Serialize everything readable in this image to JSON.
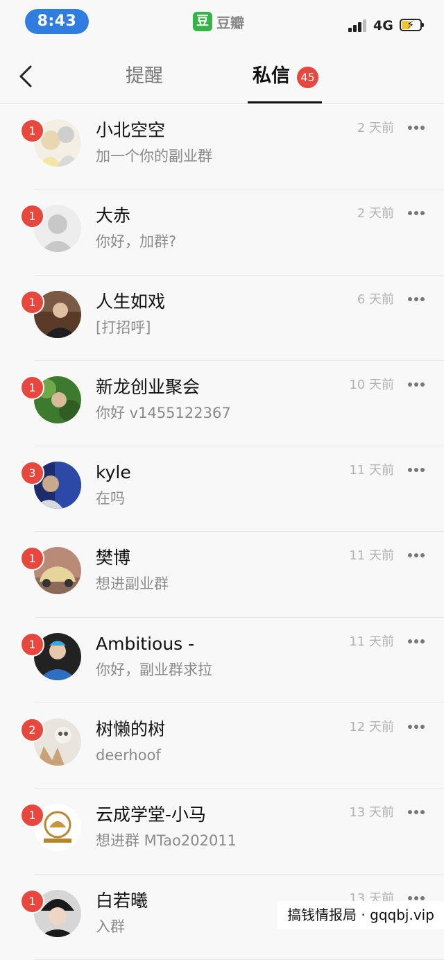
{
  "status_bar": {
    "time": "8:43",
    "app_logo": "豆",
    "app_name": "豆瓣",
    "network": "4G"
  },
  "nav": {
    "tabs": [
      {
        "label": "提醒"
      },
      {
        "label": "私信",
        "count": "45"
      }
    ]
  },
  "conversations": [
    {
      "name": "小北空空",
      "preview": "加一个你的副业群",
      "time": "2 天前",
      "unread": "1"
    },
    {
      "name": "大赤",
      "preview": "你好，加群?",
      "time": "2 天前",
      "unread": "1"
    },
    {
      "name": "人生如戏",
      "preview": "[打招呼]",
      "time": "6 天前",
      "unread": "1"
    },
    {
      "name": "新龙创业聚会",
      "preview": "你好 v1455122367",
      "time": "10 天前",
      "unread": "1"
    },
    {
      "name": "kyle",
      "preview": "在吗",
      "time": "11 天前",
      "unread": "3"
    },
    {
      "name": "樊博",
      "preview": "想进副业群",
      "time": "11 天前",
      "unread": "1"
    },
    {
      "name": "Ambitious -",
      "preview": "你好，副业群求拉",
      "time": "11 天前",
      "unread": "1"
    },
    {
      "name": "树懒的树",
      "preview": "deerhoof",
      "time": "12 天前",
      "unread": "2"
    },
    {
      "name": "云成学堂-小马",
      "preview": "想进群 MTao202011",
      "time": "13 天前",
      "unread": "1"
    },
    {
      "name": "白若曦",
      "preview": "入群",
      "time": "13 天前",
      "unread": "1"
    }
  ],
  "watermark": "搞钱情报局 · gqqbj.vip",
  "colors": {
    "accent_red": "#e8473e",
    "brand_green": "#34b446",
    "time_pill_blue": "#2f7de1"
  }
}
